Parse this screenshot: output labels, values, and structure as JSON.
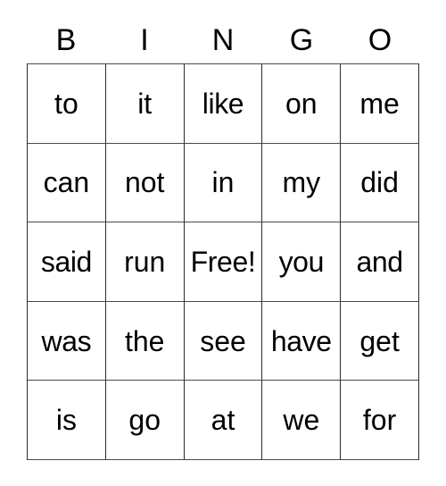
{
  "card": {
    "title": "BINGO",
    "headers": [
      "B",
      "I",
      "N",
      "G",
      "O"
    ],
    "free_space_label": "Free!",
    "free_space_position": {
      "row": 2,
      "col": 2
    },
    "grid_size": "5x5",
    "colors": {
      "background": "#ffffff",
      "text": "#000000",
      "grid_line": "#2b2b2b"
    },
    "rows": [
      {
        "cells": [
          "to",
          "it",
          "like",
          "on",
          "me"
        ]
      },
      {
        "cells": [
          "can",
          "not",
          "in",
          "my",
          "did"
        ]
      },
      {
        "cells": [
          "said",
          "run",
          "Free!",
          "you",
          "and"
        ]
      },
      {
        "cells": [
          "was",
          "the",
          "see",
          "have",
          "get"
        ]
      },
      {
        "cells": [
          "is",
          "go",
          "at",
          "we",
          "for"
        ]
      }
    ]
  }
}
